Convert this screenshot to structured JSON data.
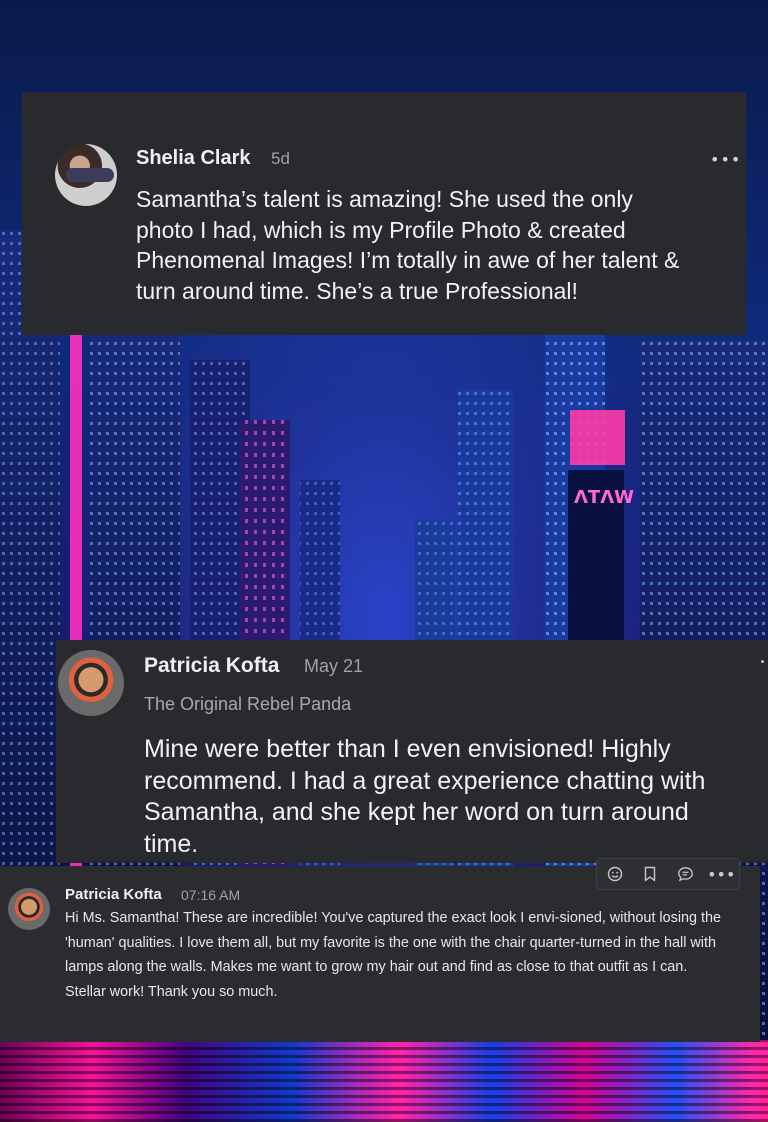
{
  "comments": [
    {
      "author": "Shelia Clark",
      "time": "5d",
      "more": "•••",
      "text": "Samantha’s talent is amazing!  She used the only photo I had, which is my Profile Photo & created Phenomenal Images!  I’m totally in awe of her talent & turn around time.  She’s a true Professional!"
    },
    {
      "author": "Patricia Kofta",
      "time": "May 21",
      "subtitle": "The Original Rebel Panda",
      "text": "Mine were better than I even envisioned! Highly recommend. I had a great experience chatting with Samantha, and she kept her word on turn around time."
    },
    {
      "author": "Patricia Kofta",
      "time": "07:16 AM",
      "text": "Hi Ms. Samantha! These are incredible! You've captured the exact look I envi-sioned, without losing the 'human' qualities. I love them all, but my favorite is the one with the chair quarter-turned in the hall with lamps along the walls. Makes me want to grow my hair out and find as close to that outfit as I can. Stellar work! Thank you so much.",
      "toolbar": {
        "icons": [
          "emoji-icon",
          "bookmark-icon",
          "reply-icon",
          "more-icon"
        ],
        "more": "•••"
      }
    }
  ],
  "background": {
    "sign_text": "ΛΤΛW",
    "accent_colors": [
      "#ff2aa0",
      "#1e3cff",
      "#0a1040"
    ]
  }
}
